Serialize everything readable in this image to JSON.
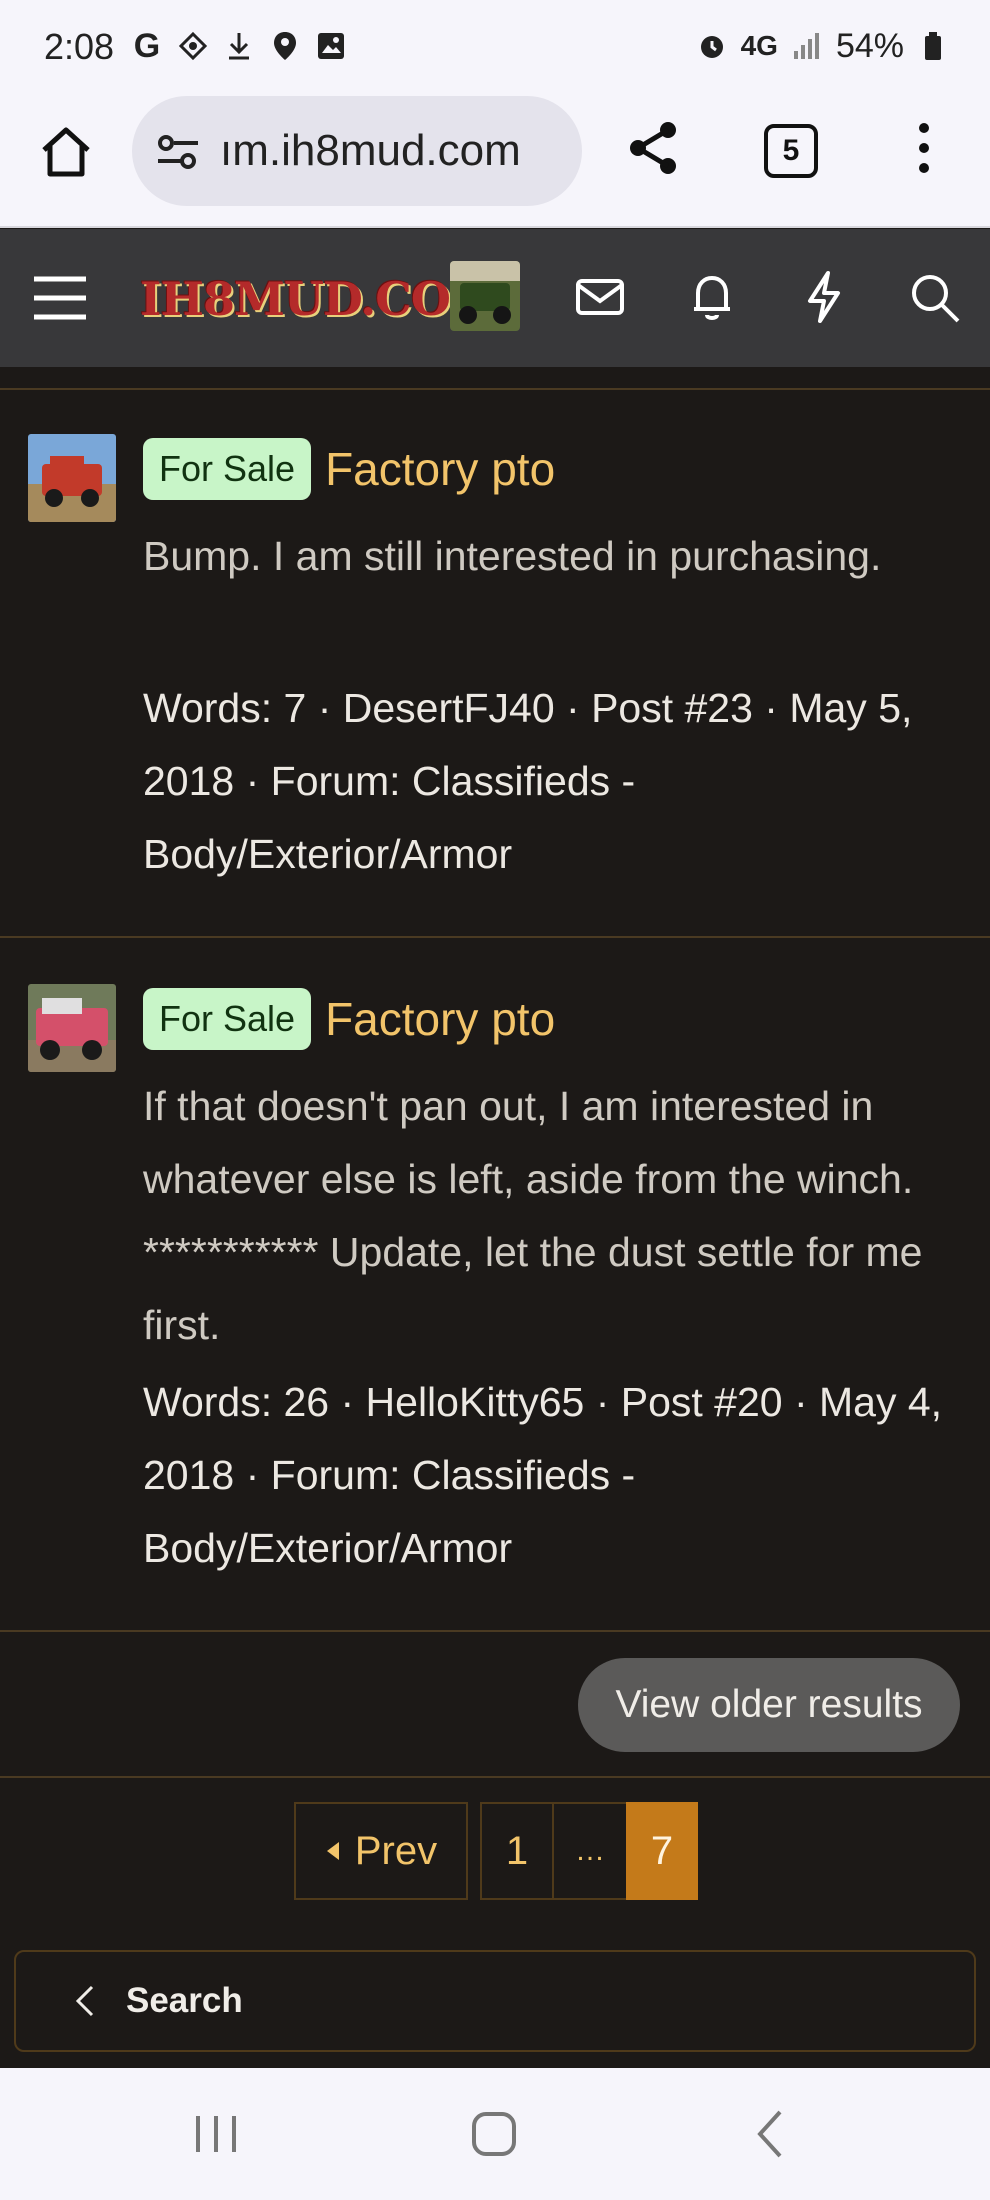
{
  "status_bar": {
    "time": "2:08",
    "network": "4G",
    "battery": "54%",
    "left_icons": [
      "google-icon",
      "nearby-icon",
      "download-icon",
      "location-icon",
      "image-icon"
    ],
    "right_icons": [
      "alarm-icon",
      "network-4g-icon",
      "signal-icon",
      "battery-icon"
    ]
  },
  "browser": {
    "url": "ım.ih8mud.com",
    "tab_count": "5"
  },
  "forum_header": {
    "logo_text": "IH8MUD.COM",
    "icons": [
      "menu-icon",
      "user-avatar",
      "mail-icon",
      "bell-icon",
      "lightning-icon",
      "search-icon"
    ]
  },
  "results": [
    {
      "badge": "For Sale",
      "title": "Factory pto",
      "snippet": "Bump. I am still interested in purchasing.",
      "meta": "Words: 7 · DesertFJ40 · Post #23 · May 5, 2018 · Forum: Classifieds - Body/Exterior/Armor",
      "avatar_color": "#c23a2a"
    },
    {
      "badge": "For Sale",
      "title": "Factory pto",
      "snippet": "If that doesn't pan out, I am interested in whatever else is left, aside from the winch. *********** Update, let the dust settle for me first.",
      "meta": "Words: 26 · HelloKitty65 · Post #20 · May 4, 2018 · Forum: Classifieds - Body/Exterior/Armor",
      "avatar_color": "#d4506a"
    }
  ],
  "view_older": "View older results",
  "pagination": {
    "prev": "Prev",
    "pages": [
      "1",
      "…",
      "7"
    ],
    "current": "7"
  },
  "back_search": "Search",
  "colors": {
    "background": "#1c1917",
    "accent": "#f2c46a",
    "current_page": "#c47a1a",
    "badge": "#c8f5c8"
  }
}
